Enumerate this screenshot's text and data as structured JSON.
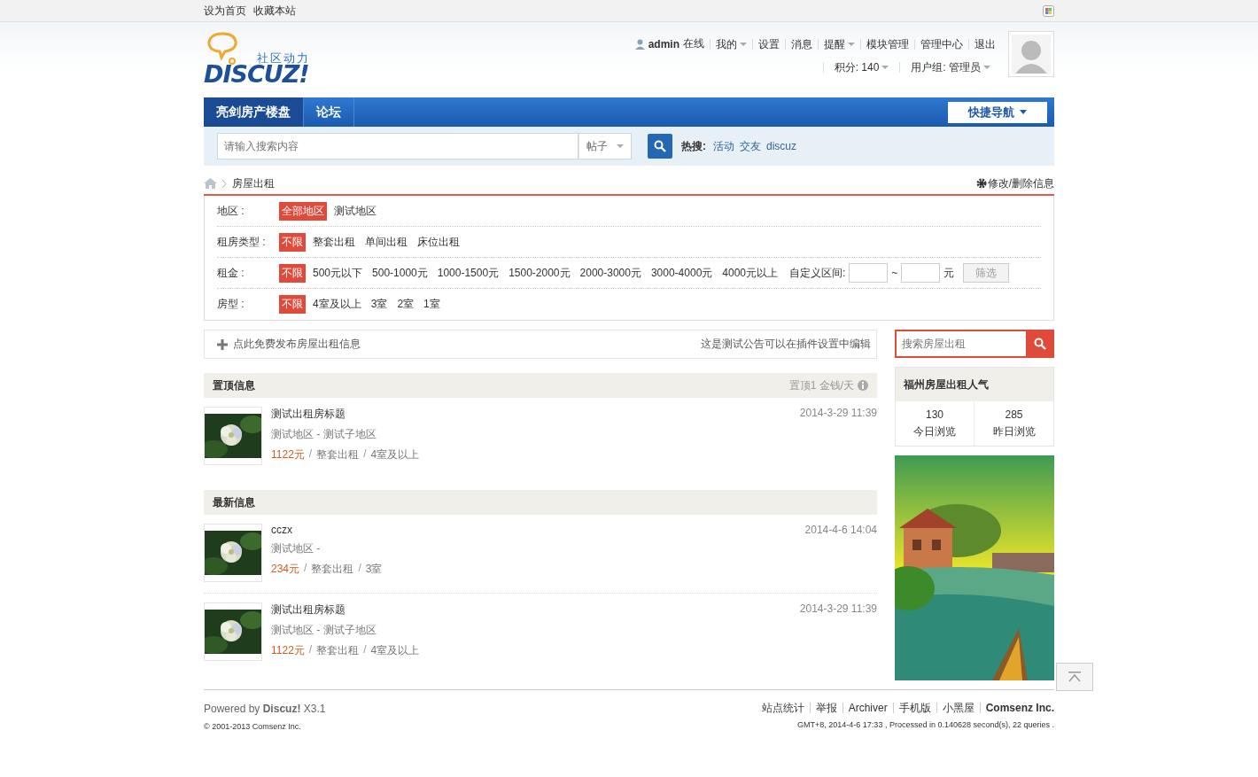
{
  "topbar": {
    "links": [
      "设为首页",
      "收藏本站"
    ]
  },
  "header": {
    "logo": {
      "wordmark": "DISCUZ!",
      "tagline": "社区动力"
    },
    "user": {
      "name": "admin",
      "status": "在线"
    },
    "user_menu": [
      {
        "label": "我的",
        "dropdown": true
      },
      {
        "label": "设置",
        "dropdown": false
      },
      {
        "label": "消息",
        "dropdown": false
      },
      {
        "label": "提醒",
        "dropdown": true
      },
      {
        "label": "模块管理",
        "dropdown": false
      },
      {
        "label": "管理中心",
        "dropdown": false
      },
      {
        "label": "退出",
        "dropdown": false
      }
    ],
    "stats": [
      {
        "label": "积分: 140",
        "dropdown": true
      },
      {
        "label": "用户组: 管理员",
        "dropdown": true
      }
    ]
  },
  "nav": {
    "items": [
      {
        "label": "亮剑房产楼盘",
        "selected": true
      },
      {
        "label": "论坛",
        "selected": false
      }
    ],
    "quick_nav": "快捷导航"
  },
  "search": {
    "placeholder": "请输入搜索内容",
    "type": "帖子",
    "hot_label": "热搜:",
    "hot": [
      "活动",
      "交友",
      "discuz"
    ]
  },
  "breadcrumb": {
    "current": "房屋出租",
    "action": "修改/删除信息"
  },
  "filters": [
    {
      "label": "地区 :",
      "options": [
        {
          "label": "全部地区",
          "selected": true
        },
        {
          "label": "测试地区",
          "selected": false
        }
      ]
    },
    {
      "label": "租房类型 :",
      "options": [
        {
          "label": "不限",
          "selected": true
        },
        {
          "label": "整套出租",
          "selected": false
        },
        {
          "label": "单间出租",
          "selected": false
        },
        {
          "label": "床位出租",
          "selected": false
        }
      ]
    },
    {
      "label": "租金 :",
      "options": [
        {
          "label": "不限",
          "selected": true
        },
        {
          "label": "500元以下",
          "selected": false
        },
        {
          "label": "500-1000元",
          "selected": false
        },
        {
          "label": "1000-1500元",
          "selected": false
        },
        {
          "label": "1500-2000元",
          "selected": false
        },
        {
          "label": "2000-3000元",
          "selected": false
        },
        {
          "label": "3000-4000元",
          "selected": false
        },
        {
          "label": "4000元以上",
          "selected": false
        }
      ],
      "custom": {
        "label": "自定义区间:",
        "separator": "~",
        "unit": "元",
        "button": "筛选"
      }
    },
    {
      "label": "房型 :",
      "options": [
        {
          "label": "不限",
          "selected": true
        },
        {
          "label": "4室及以上",
          "selected": false
        },
        {
          "label": "3室",
          "selected": false
        },
        {
          "label": "2室",
          "selected": false
        },
        {
          "label": "1室",
          "selected": false
        }
      ]
    }
  ],
  "notice": {
    "post": "点此免费发布房屋出租信息",
    "text": "这是测试公告可以在插件设置中编辑"
  },
  "separator": "/",
  "sections": [
    {
      "title": "置顶信息",
      "note": "置顶1 金钱/天",
      "listings": [
        {
          "title": "测试出租房标题",
          "area": "测试地区 - 测试子地区",
          "price": "1122元",
          "type": "整套出租",
          "rooms": "4室及以上",
          "date": "2014-3-29 11:39"
        }
      ]
    },
    {
      "title": "最新信息",
      "listings": [
        {
          "title": "cczx",
          "area": "测试地区 -",
          "price": "234元",
          "type": "整套出租",
          "rooms": "3室",
          "date": "2014-4-6 14:04"
        },
        {
          "title": "测试出租房标题",
          "area": "测试地区 - 测试子地区",
          "price": "1122元",
          "type": "整套出租",
          "rooms": "4室及以上",
          "date": "2014-3-29 11:39"
        }
      ]
    }
  ],
  "sidebar": {
    "search_placeholder": "搜索房屋出租",
    "stats_title": "福州房屋出租人气",
    "stats": [
      {
        "value": "130",
        "label": "今日浏览"
      },
      {
        "value": "285",
        "label": "昨日浏览"
      }
    ]
  },
  "footer": {
    "powered": "Powered by **Discuz!** X3.1",
    "copyright": "© 2001-2013 Comsenz Inc.",
    "links": [
      {
        "label": "站点统计",
        "bold": false
      },
      {
        "label": "举报",
        "bold": false
      },
      {
        "label": "Archiver",
        "bold": false
      },
      {
        "label": "手机版",
        "bold": false
      },
      {
        "label": "小黑屋",
        "bold": false
      },
      {
        "label": "Comsenz Inc.",
        "bold": true
      }
    ],
    "info": "GMT+8, 2014-4-6 17:33 , Processed in 0.140628 second(s), 22 queries ."
  }
}
